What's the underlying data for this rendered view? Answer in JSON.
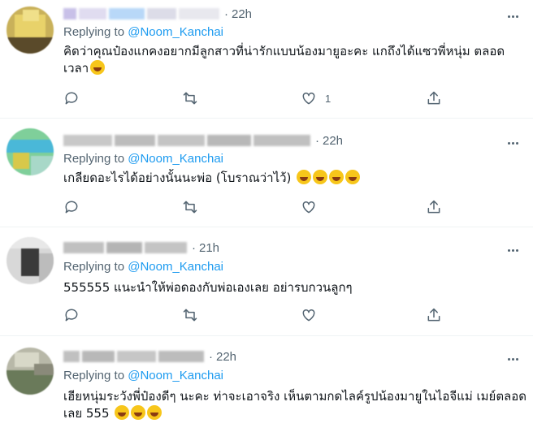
{
  "tweets": [
    {
      "time": "22h",
      "replying_prefix": "Replying to ",
      "replying_handle": "@Noom_Kanchai",
      "text": "คิดว่าคุณป๋องแกคงอยากมีลูกสาวที่น่ารักแบบน้องมายูอะคะ แกถึงได้แซวพี่หนุ่ม ตลอดเวลา",
      "emoji_icons": [
        "face-with-tears-of-joy-icon"
      ],
      "reply_count": "",
      "retweet_count": "",
      "like_count": "1",
      "avatar_colors": [
        "#c9b15a",
        "#e8d26a",
        "#5a4a2a",
        "#f0e08a"
      ]
    },
    {
      "time": "22h",
      "replying_prefix": "Replying to ",
      "replying_handle": "@Noom_Kanchai",
      "text": "เกลียดอะไรได้อย่างนั้นนะพ่อ (โบราณว่าไว้) ",
      "emoji_icons": [
        "zany-face-icon",
        "zany-face-icon",
        "zany-face-icon",
        "zany-face-icon"
      ],
      "reply_count": "",
      "retweet_count": "",
      "like_count": "",
      "avatar_colors": [
        "#7fcf9a",
        "#4ab8d8",
        "#d8c84a",
        "#a8d8c8"
      ]
    },
    {
      "time": "21h",
      "replying_prefix": "Replying to ",
      "replying_handle": "@Noom_Kanchai",
      "text": "555555 แนะนำให้พ่อดองกับพ่อเองเลย อย่ารบกวนลูกๆ",
      "emoji_icons": [],
      "reply_count": "",
      "retweet_count": "",
      "like_count": "",
      "avatar_colors": [
        "#d8d8d8",
        "#3a3a3a",
        "#bcbcbc",
        "#e8e8e8"
      ]
    },
    {
      "time": "22h",
      "replying_prefix": "Replying to ",
      "replying_handle": "@Noom_Kanchai",
      "text": "เฮียหนุ่มระวังพี่ป๋องดีๆ นะคะ ท่าจะเอาจริง เห็นตามกดไลค์รูปน้องมายูในไอจีแม่ เมย์ตลอดเลย 555 ",
      "emoji_icons": [
        "rolling-on-floor-laughing-icon",
        "rolling-on-floor-laughing-icon",
        "rolling-on-floor-laughing-icon"
      ],
      "reply_count": "",
      "retweet_count": "",
      "like_count": "",
      "avatar_colors": [
        "#b8b8a8",
        "#6a7a5a",
        "#d8d8c8",
        "#8a8a7a"
      ]
    }
  ]
}
